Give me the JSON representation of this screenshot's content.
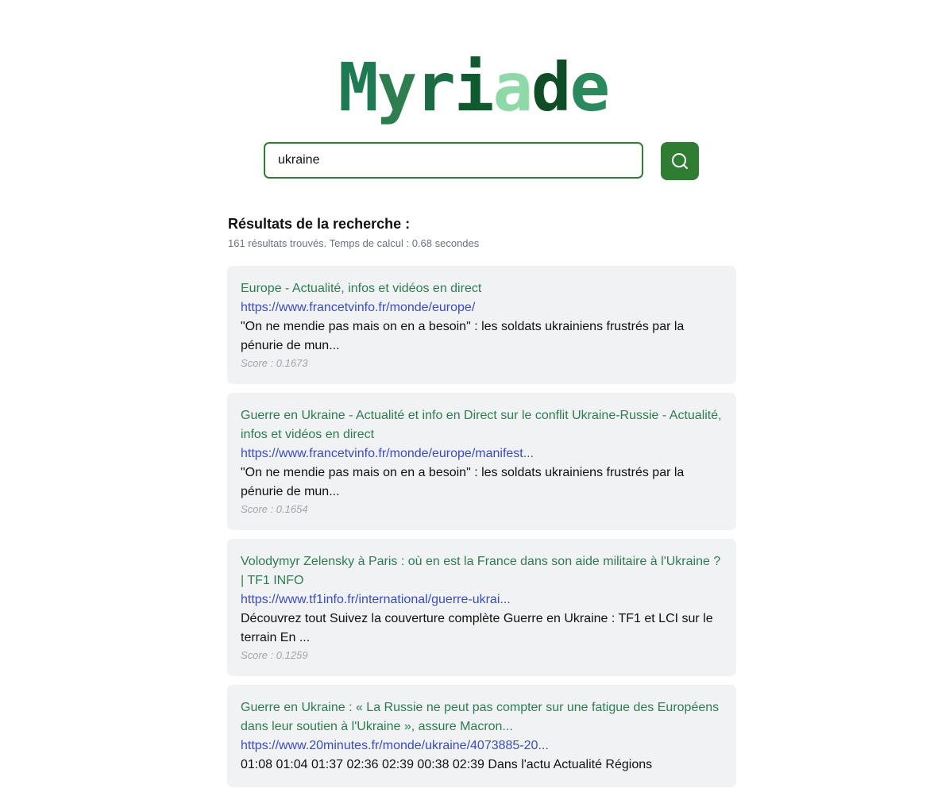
{
  "logo": {
    "letters": [
      {
        "char": "M",
        "color": "#1e7a52"
      },
      {
        "char": "y",
        "color": "#2e7d4f"
      },
      {
        "char": "r",
        "color": "#1b6b45"
      },
      {
        "char": "i",
        "color": "#0f5a2e"
      },
      {
        "char": "a",
        "color": "#8fd9a8"
      },
      {
        "char": "d",
        "color": "#0f4d26"
      },
      {
        "char": "e",
        "color": "#2a8a5e"
      }
    ]
  },
  "search": {
    "value": "ukraine",
    "placeholder": ""
  },
  "results_header": {
    "title": "Résultats de la recherche :",
    "stats": "161 résultats trouvés. Temps de calcul : 0.68 secondes"
  },
  "results": [
    {
      "title": "Europe - Actualité, infos et vidéos en direct",
      "url": "https://www.francetvinfo.fr/monde/europe/",
      "snippet": "\"On ne mendie pas mais on en a besoin\" : les soldats ukrainiens frustrés par la pénurie de mun...",
      "score": "Score : 0.1673"
    },
    {
      "title": "Guerre en Ukraine - Actualité et info en Direct sur le conflit Ukraine-Russie - Actualité, infos et vidéos en direct",
      "url": "https://www.francetvinfo.fr/monde/europe/manifest...",
      "snippet": "\"On ne mendie pas mais on en a besoin\" : les soldats ukrainiens frustrés par la pénurie de mun...",
      "score": "Score : 0.1654"
    },
    {
      "title": "Volodymyr Zelensky à Paris : où en est la France dans son aide militaire à l'Ukraine ? | TF1 INFO",
      "url": "https://www.tf1info.fr/international/guerre-ukrai...",
      "snippet": "Découvrez tout Suivez la couverture complète Guerre en Ukraine : TF1 et LCI sur le terrain En ...",
      "score": "Score : 0.1259"
    },
    {
      "title": "Guerre en Ukraine : « La Russie ne peut pas compter sur une fatigue des Européens dans leur soutien à l'Ukraine », assure Macron...",
      "url": "https://www.20minutes.fr/monde/ukraine/4073885-20...",
      "snippet": "01:08 01:04 01:37 02:36 02:39 00:38 02:39 Dans l'actu Actualité Régions",
      "score": ""
    }
  ]
}
